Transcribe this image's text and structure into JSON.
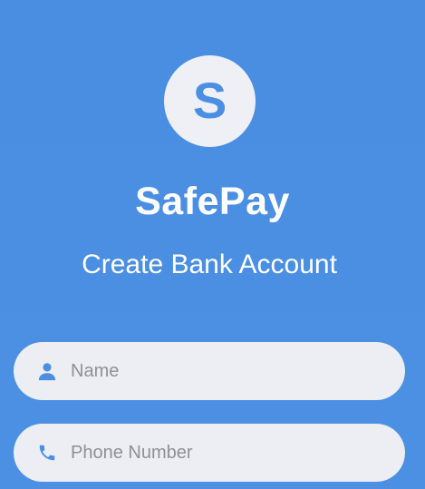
{
  "header": {
    "logo_letter": "S",
    "app_name": "SafePay",
    "subtitle": "Create Bank Account"
  },
  "form": {
    "name": {
      "icon": "person-icon",
      "placeholder": "Name",
      "value": ""
    },
    "phone": {
      "icon": "phone-icon",
      "placeholder": "Phone Number",
      "value": ""
    }
  },
  "colors": {
    "background": "#4b8fe2",
    "field_background": "#eceef3",
    "accent": "#4b8fe2"
  }
}
